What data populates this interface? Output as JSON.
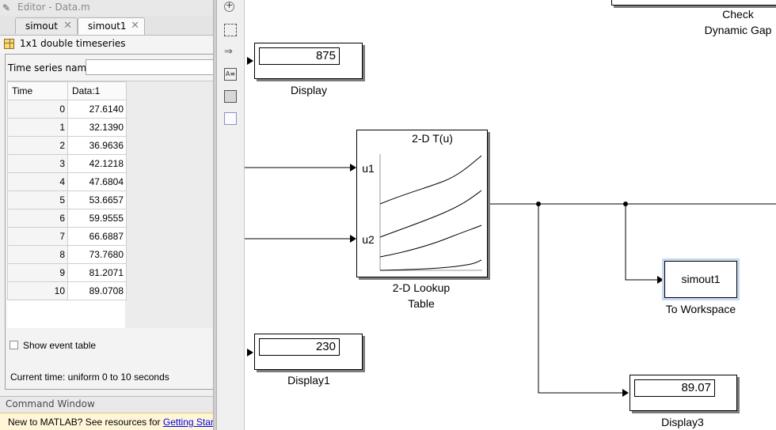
{
  "editor": {
    "title": "Editor - Data.m"
  },
  "tabs": [
    {
      "label": "simout"
    },
    {
      "label": "simout1"
    }
  ],
  "variable": {
    "summary": "1x1 double timeseries"
  },
  "timeseries": {
    "name_label": "Time series name:",
    "name_value": "",
    "columns": [
      "Time",
      "Data:1"
    ],
    "rows": [
      [
        "0",
        "27.6140"
      ],
      [
        "1",
        "32.1390"
      ],
      [
        "2",
        "36.9636"
      ],
      [
        "3",
        "42.1218"
      ],
      [
        "4",
        "47.6804"
      ],
      [
        "5",
        "53.6657"
      ],
      [
        "6",
        "59.9555"
      ],
      [
        "7",
        "66.6887"
      ],
      [
        "8",
        "73.7680"
      ],
      [
        "9",
        "81.2071"
      ],
      [
        "10",
        "89.0708"
      ]
    ],
    "event_checkbox_label": "Show event table",
    "event_checked": false,
    "current_time": "Current time: uniform 0 to 10 seconds"
  },
  "command_window": {
    "title": "Command Window",
    "message": "New to MATLAB? See resources for ",
    "link": "Getting Starte"
  },
  "toolbar": {
    "icons": [
      "zoom-icon",
      "fit-view-icon",
      "connector-arrow-icon",
      "annotation-icon",
      "image-icon",
      "area-icon"
    ]
  },
  "model": {
    "check_block": {
      "label_line1": "Check",
      "label_line2": "Dynamic Gap"
    },
    "display": {
      "value": "875",
      "label": "Display"
    },
    "lookup": {
      "title": "2-D T(u)",
      "input1": "u1",
      "input2": "u2",
      "label_line1": "2-D Lookup",
      "label_line2": "Table"
    },
    "workspace": {
      "var_name": "simout1",
      "label": "To Workspace"
    },
    "display1": {
      "value": "230",
      "label": "Display1"
    },
    "display3": {
      "value": "89.07",
      "label": "Display3"
    }
  },
  "colors": {
    "selection": "#c6d8f0",
    "command_banner": "#fff6d8",
    "link": "#0000ee"
  }
}
